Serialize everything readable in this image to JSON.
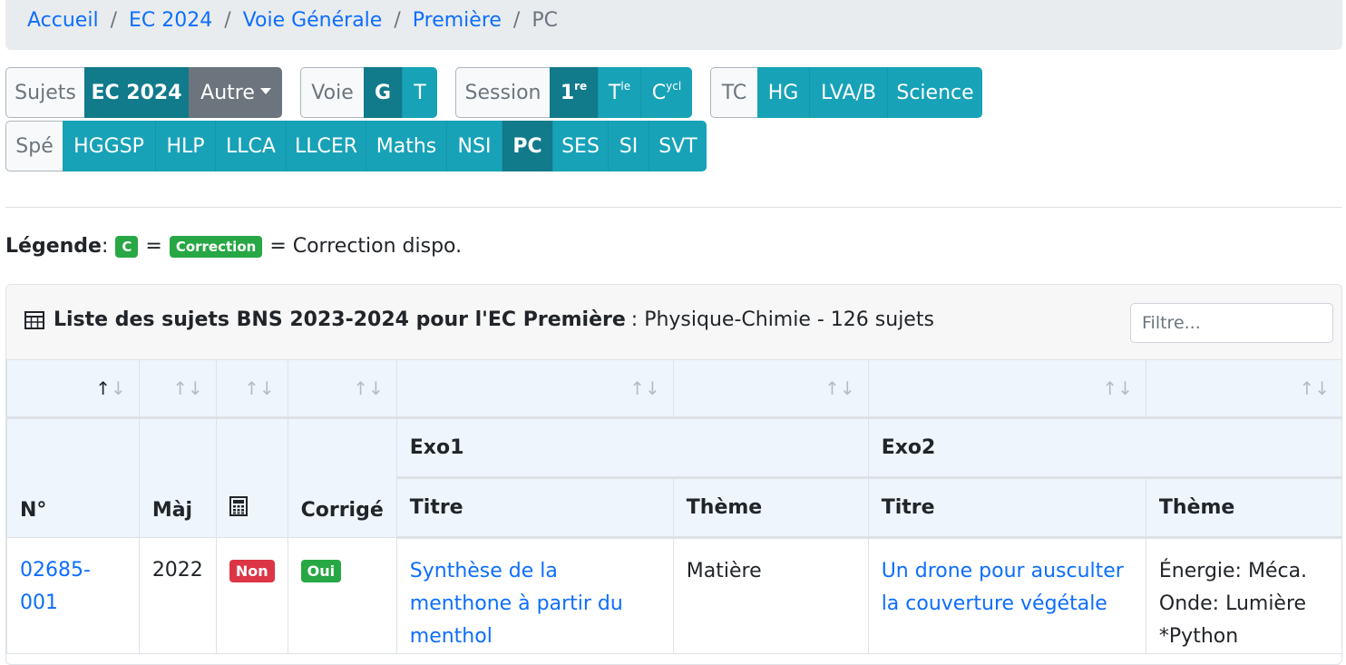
{
  "breadcrumb": {
    "items": [
      "Accueil",
      "EC 2024",
      "Voie Générale",
      "Première"
    ],
    "current": "PC",
    "separator": "/"
  },
  "filters": {
    "sujets": {
      "label": "Sujets",
      "active": "EC 2024",
      "dropdown": "Autre"
    },
    "voie": {
      "label": "Voie",
      "options": [
        "G",
        "T"
      ],
      "active": "G"
    },
    "session": {
      "label": "Session",
      "options": [
        {
          "base": "1",
          "sup": "re"
        },
        {
          "base": "T",
          "sup": "le"
        },
        {
          "base": "C",
          "sup": "ycl"
        }
      ],
      "active_index": 0
    },
    "tc": {
      "label": "TC",
      "options": [
        "HG",
        "LVA/B",
        "Science"
      ]
    },
    "spe": {
      "label": "Spé",
      "options": [
        "HGGSP",
        "HLP",
        "LLCA",
        "LLCER",
        "Maths",
        "NSI",
        "PC",
        "SES",
        "SI",
        "SVT"
      ],
      "active": "PC"
    }
  },
  "legend": {
    "label": "Légende",
    "colon": " :",
    "badge_short": "C",
    "equals": "=",
    "badge_long": "Correction",
    "text": "= Correction dispo."
  },
  "card": {
    "title_bold": "Liste des sujets BNS 2023-2024 pour l'EC Première",
    "title_rest": ": Physique-Chimie - 126 sujets",
    "filter_placeholder": "Filtre..."
  },
  "table": {
    "sort_glyph_up": "↑",
    "sort_glyph_down": "↓",
    "groups": {
      "exo1": "Exo1",
      "exo2": "Exo2"
    },
    "headers": {
      "num": "N°",
      "maj": "Màj",
      "corrige": "Corrigé",
      "titre1": "Titre",
      "theme1": "Thème",
      "titre2": "Titre",
      "theme2": "Thème"
    },
    "rows": [
      {
        "num": "02685-001",
        "maj": "2022",
        "calc": "Non",
        "corrige": "Oui",
        "titre1": "Synthèse de la menthone à partir du menthol",
        "theme1": "Matière",
        "titre2": "Un drone pour ausculter la couverture végétale",
        "theme2": [
          "Énergie: Méca.",
          "Onde: Lumière",
          "*Python"
        ]
      }
    ]
  },
  "colors": {
    "accent": "#17a2b8",
    "active": "#117a8b",
    "link": "#0d6efd",
    "success": "#28a745",
    "danger": "#dc3545"
  }
}
